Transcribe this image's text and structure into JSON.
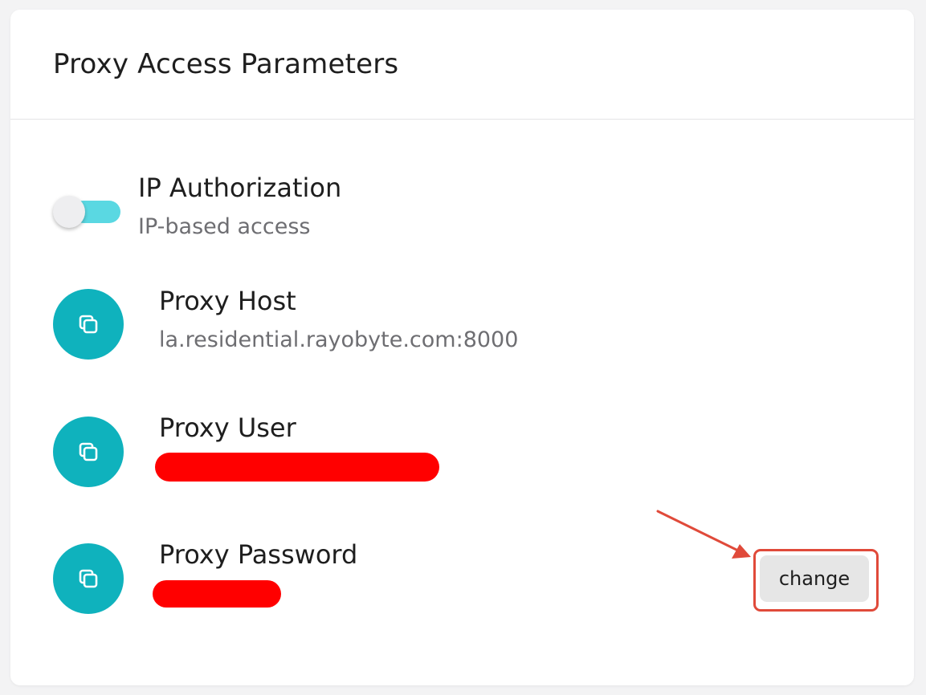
{
  "card": {
    "title": "Proxy Access Parameters"
  },
  "ip_authorization": {
    "title": "IP Authorization",
    "subtitle": "IP-based access",
    "enabled": false
  },
  "fields": [
    {
      "label": "Proxy Host",
      "value": "la.residential.rayobyte.com:8000",
      "icon": "copy-icon"
    },
    {
      "label": "Proxy User",
      "value_redacted": true,
      "icon": "copy-icon"
    },
    {
      "label": "Proxy Password",
      "value_redacted": true,
      "icon": "copy-icon"
    }
  ],
  "change_button": {
    "label": "change"
  },
  "colors": {
    "accent": "#0fb2bd",
    "toggle_track": "#5ad8e2",
    "redaction": "#ff0000",
    "annotation": "#e04a3a"
  }
}
